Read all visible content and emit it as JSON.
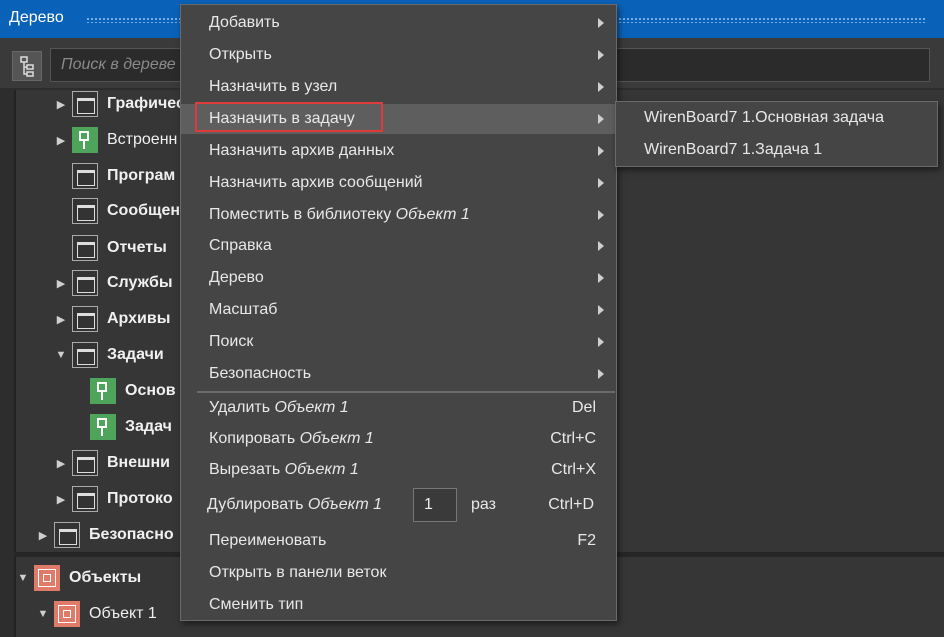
{
  "window": {
    "title": "Дерево"
  },
  "search": {
    "placeholder": "Поиск в дереве"
  },
  "tree": {
    "items": [
      {
        "label": "Графичес",
        "bold": true
      },
      {
        "label": "Встроенн",
        "bold": false
      },
      {
        "label": "Програм",
        "bold": true
      },
      {
        "label": "Сообщен",
        "bold": true
      },
      {
        "label": "Отчеты",
        "bold": true
      },
      {
        "label": "Службы",
        "bold": true
      },
      {
        "label": "Архивы",
        "bold": true
      },
      {
        "label": "Задачи",
        "bold": true
      },
      {
        "label": "Основ",
        "bold": true
      },
      {
        "label": "Задач",
        "bold": true
      },
      {
        "label": "Внешни",
        "bold": true
      },
      {
        "label": "Протоко",
        "bold": true
      },
      {
        "label": "Безопасно",
        "bold": true
      }
    ],
    "objects": {
      "label": "Объекты"
    },
    "object1": {
      "label": "Объект 1"
    }
  },
  "context_menu": {
    "items": [
      {
        "label": "Добавить",
        "submenu": true
      },
      {
        "label": "Открыть",
        "submenu": true
      },
      {
        "label": "Назначить в узел",
        "submenu": true
      },
      {
        "label": "Назначить в задачу",
        "submenu": true,
        "highlighted": true
      },
      {
        "label": "Назначить архив данных",
        "submenu": true
      },
      {
        "label": "Назначить архив сообщений",
        "submenu": true
      },
      {
        "label": "Поместить в библиотеку",
        "italic": "Объект 1",
        "submenu": true
      },
      {
        "label": "Справка",
        "submenu": true
      },
      {
        "label": "Дерево",
        "submenu": true
      },
      {
        "label": "Масштаб",
        "submenu": true
      },
      {
        "label": "Поиск",
        "submenu": true
      },
      {
        "label": "Безопасность",
        "submenu": true
      },
      {
        "label": "Удалить",
        "italic": "Объект 1",
        "shortcut": "Del"
      },
      {
        "label": "Копировать",
        "italic": "Объект 1",
        "shortcut": "Ctrl+C"
      },
      {
        "label": "Вырезать",
        "italic": "Объект 1",
        "shortcut": "Ctrl+X"
      },
      {
        "label": "Дублировать",
        "italic": "Объект 1",
        "shortcut": "Ctrl+D",
        "count": "1",
        "count_suffix": "раз"
      },
      {
        "label": "Переименовать",
        "shortcut": "F2"
      },
      {
        "label": "Открыть в панели веток"
      },
      {
        "label": "Сменить тип"
      }
    ]
  },
  "submenu": {
    "items": [
      {
        "label": "WirenBoard7 1.Основная задача"
      },
      {
        "label": "WirenBoard7 1.Задача 1"
      }
    ]
  },
  "colors": {
    "titlebar": "#0a62b8",
    "highlight_border": "#e03b3b",
    "menu_bg": "#454545"
  }
}
